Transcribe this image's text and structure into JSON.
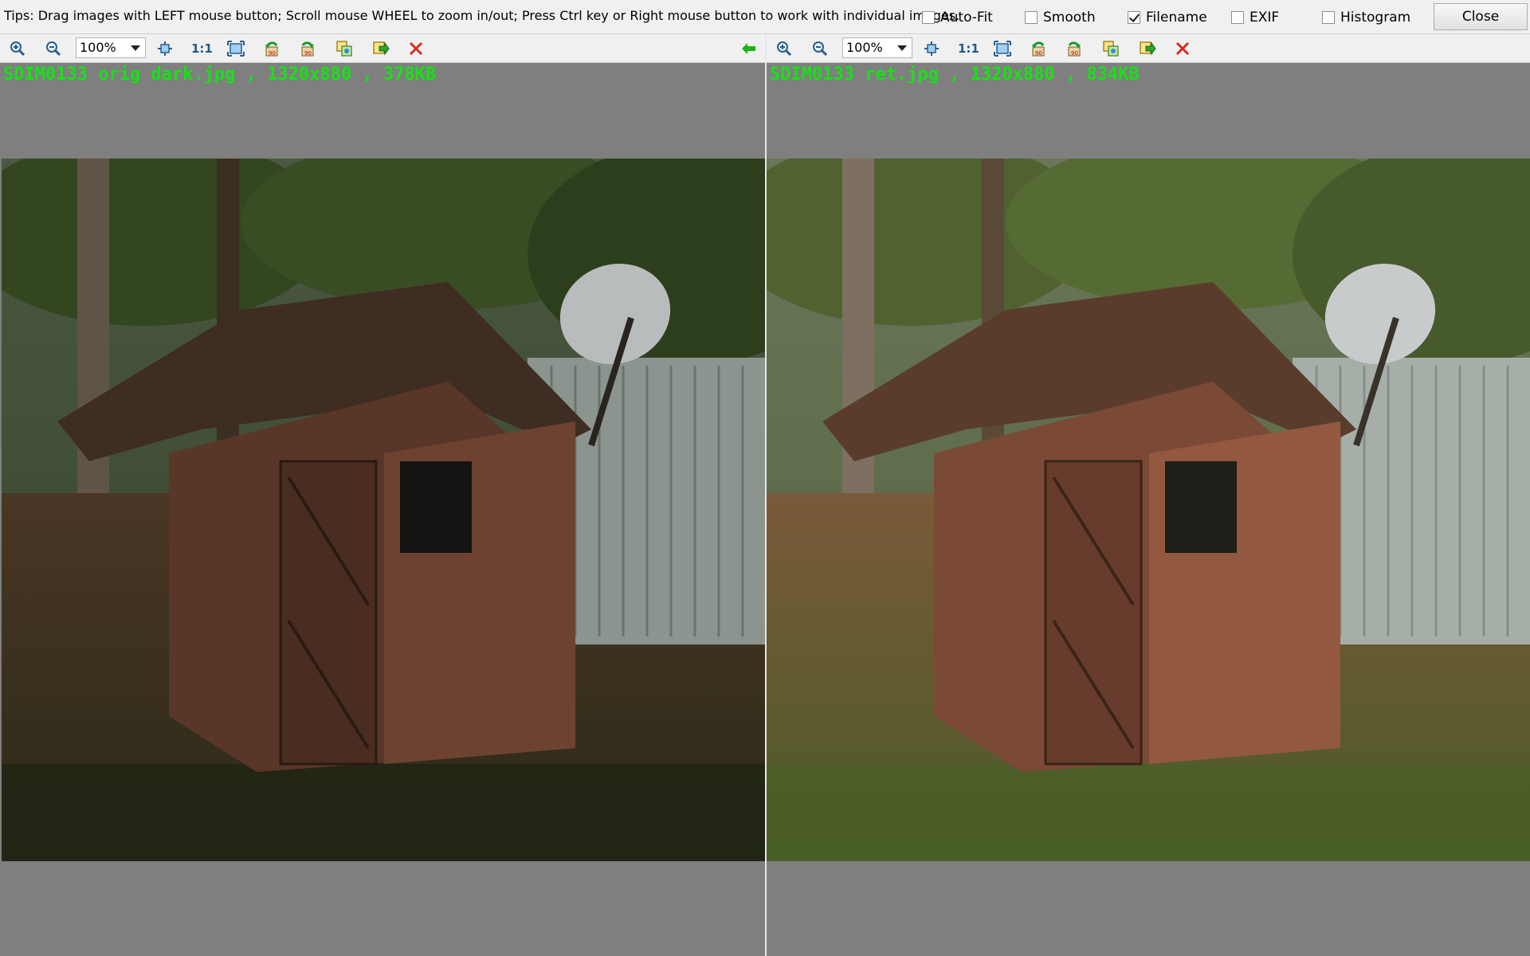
{
  "tips": "Tips: Drag images with LEFT mouse button; Scroll mouse WHEEL to zoom in/out; Press Ctrl key or Right mouse button to work with individual images.",
  "options": [
    {
      "label": "Auto-Fit",
      "checked": false
    },
    {
      "label": "Smooth",
      "checked": false
    },
    {
      "label": "Filename",
      "checked": true
    },
    {
      "label": "EXIF",
      "checked": false
    },
    {
      "label": "Histogram",
      "checked": false
    }
  ],
  "close_label": "Close",
  "left": {
    "zoom": "100%",
    "one_to_one": "1:1",
    "fileinfo": "SDIM0133 orig dark.jpg , 1320x880 , 378KB"
  },
  "right": {
    "zoom": "100%",
    "one_to_one": "1:1",
    "fileinfo": "SDIM0133 ret.jpg , 1320x880 , 834KB"
  },
  "icons": [
    "zoom-in-icon",
    "zoom-out-icon",
    "fit-icon",
    "actual-size-icon",
    "full-screen-icon",
    "rotate-left-icon",
    "rotate-right-icon",
    "copy-icon",
    "export-icon",
    "close-image-icon",
    "sync-arrow-icon"
  ],
  "colors": {
    "filename_text": "#19e019",
    "pane_bg": "#7f7f7f"
  }
}
